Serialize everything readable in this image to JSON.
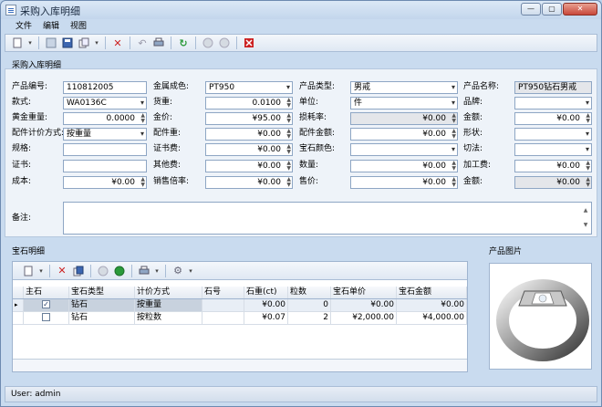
{
  "window": {
    "title": "采购入库明细"
  },
  "menu": [
    "文件",
    "编辑",
    "视图"
  ],
  "sections": {
    "main": "采购入库明细",
    "gems": "宝石明细",
    "photo": "产品图片"
  },
  "form": {
    "product_code": {
      "label": "产品编号:",
      "value": "110812005"
    },
    "metal_color": {
      "label": "金属成色:",
      "value": "PT950"
    },
    "product_type": {
      "label": "产品类型:",
      "value": "男戒"
    },
    "product_name": {
      "label": "产品名称:",
      "value": "PT950钻石男戒"
    },
    "style": {
      "label": "款式:",
      "value": "WA0136C"
    },
    "weight": {
      "label": "货重:",
      "value": "0.0100"
    },
    "unit": {
      "label": "单位:",
      "value": "件"
    },
    "brand": {
      "label": "品牌:",
      "value": ""
    },
    "gold_weight": {
      "label": "黄金重量:",
      "value": "0.0000"
    },
    "gold_price": {
      "label": "金价:",
      "value": "¥95.00"
    },
    "loss_rate": {
      "label": "损耗率:",
      "value": "¥0.00"
    },
    "amount": {
      "label": "金额:",
      "value": "¥0.00"
    },
    "accessory_pricing": {
      "label": "配件计价方式:",
      "value": "按重量"
    },
    "accessory_weight": {
      "label": "配件重:",
      "value": "¥0.00"
    },
    "accessory_amount": {
      "label": "配件金额:",
      "value": "¥0.00"
    },
    "shape": {
      "label": "形状:",
      "value": ""
    },
    "spec": {
      "label": "规格:",
      "value": ""
    },
    "cert_fee": {
      "label": "证书费:",
      "value": "¥0.00"
    },
    "gem_color": {
      "label": "宝石颜色:",
      "value": ""
    },
    "cut": {
      "label": "切法:",
      "value": ""
    },
    "certificate": {
      "label": "证书:",
      "value": ""
    },
    "other_fee": {
      "label": "其他费:",
      "value": "¥0.00"
    },
    "quantity": {
      "label": "数量:",
      "value": "¥0.00"
    },
    "processing_fee": {
      "label": "加工费:",
      "value": "¥0.00"
    },
    "cost": {
      "label": "成本:",
      "value": "¥0.00"
    },
    "sales_multiplier": {
      "label": "销售倍率:",
      "value": "¥0.00"
    },
    "sale_price": {
      "label": "售价:",
      "value": "¥0.00"
    },
    "amount2": {
      "label": "金额:",
      "value": "¥0.00"
    },
    "notes": {
      "label": "备注:",
      "value": ""
    }
  },
  "gem_table": {
    "headers": [
      "主石",
      "宝石类型",
      "计价方式",
      "石号",
      "石重(ct)",
      "粒数",
      "宝石单价",
      "宝石金额"
    ],
    "rows": [
      {
        "main": true,
        "type": "钻石",
        "pricing": "按重量",
        "stone_no": "",
        "weight": "¥0.00",
        "count": "0",
        "unit_price": "¥0.00",
        "amount": "¥0.00"
      },
      {
        "main": false,
        "type": "钻石",
        "pricing": "按粒数",
        "stone_no": "",
        "weight": "¥0.07",
        "count": "2",
        "unit_price": "¥2,000.00",
        "amount": "¥4,000.00"
      }
    ]
  },
  "status": {
    "user": "User: admin"
  },
  "icons": {
    "toolbar": [
      "new-icon",
      "save-icon",
      "save-all-icon",
      "copy-icon",
      "delete-icon",
      "undo-icon",
      "print-icon",
      "refresh-icon",
      "prev-icon",
      "next-icon",
      "close-red-icon"
    ],
    "gem_toolbar": [
      "new-icon",
      "delete-icon",
      "copy-icon",
      "prev-icon",
      "next-icon",
      "print-icon",
      "settings-icon"
    ]
  },
  "colors": {
    "accent": "#3a70c0",
    "delete": "#cc2222",
    "refresh": "#2a9a3a"
  }
}
